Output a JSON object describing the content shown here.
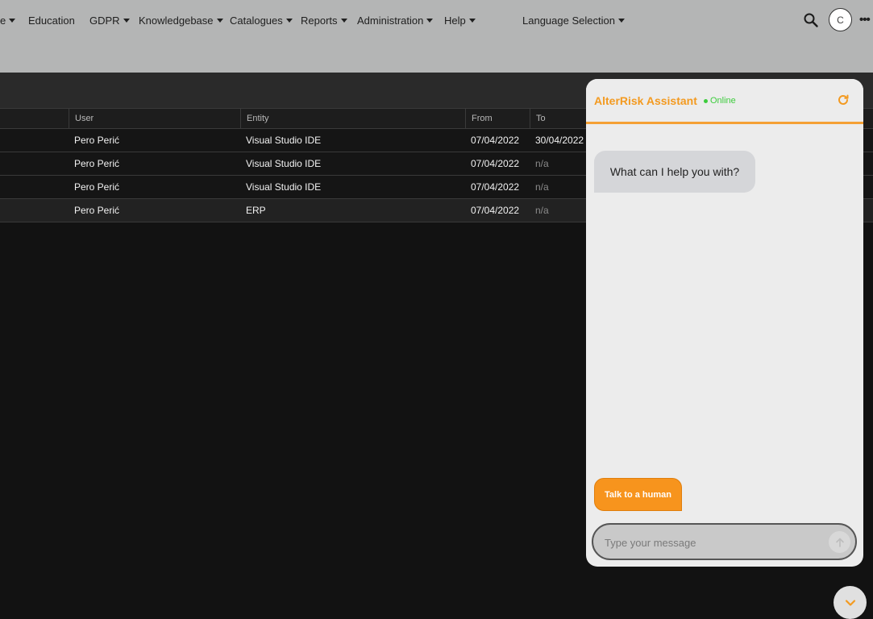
{
  "nav": {
    "items": [
      {
        "label": "e",
        "has_caret": true
      },
      {
        "label": "Education",
        "has_caret": false
      },
      {
        "label": "GDPR",
        "has_caret": true
      },
      {
        "label": "Knowledgebase",
        "has_caret": true
      },
      {
        "label": "Catalogues",
        "has_caret": true
      },
      {
        "label": "Reports",
        "has_caret": true
      },
      {
        "label": "Administration",
        "has_caret": true
      },
      {
        "label": "Help",
        "has_caret": true
      }
    ],
    "language": "Language Selection",
    "avatar_initial": "C",
    "search_icon": "search-icon",
    "more_icon": "more-horizontal-icon"
  },
  "table": {
    "columns": [
      "User",
      "Entity",
      "From",
      "To"
    ],
    "rows": [
      {
        "user": "Pero Perić",
        "entity": "Visual Studio IDE",
        "from": "07/04/2022",
        "to": "30/04/2022"
      },
      {
        "user": "Pero Perić",
        "entity": "Visual Studio IDE",
        "from": "07/04/2022",
        "to": "n/a"
      },
      {
        "user": "Pero Perić",
        "entity": "Visual Studio IDE",
        "from": "07/04/2022",
        "to": "n/a"
      },
      {
        "user": "Pero Perić",
        "entity": "ERP",
        "from": "07/04/2022",
        "to": "n/a"
      }
    ]
  },
  "chat": {
    "title": "AlterRisk Assistant",
    "status": "Online",
    "greeting": "What can I help you with?",
    "human_button": "Talk to a human",
    "input_placeholder": "Type your message",
    "accent_color": "#f39a20",
    "status_color": "#3dcc3d"
  }
}
